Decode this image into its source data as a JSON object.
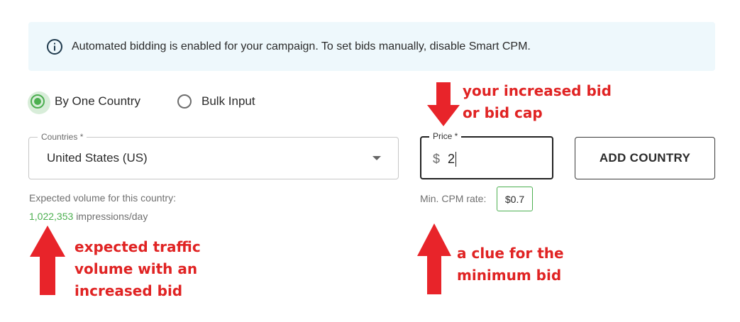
{
  "banner": {
    "text": "Automated bidding is enabled for your campaign. To set bids manually, disable Smart CPM.",
    "icon": "info-icon"
  },
  "radio_options": [
    {
      "label": "By One Country",
      "checked": true
    },
    {
      "label": "Bulk Input",
      "checked": false
    }
  ],
  "countries_field": {
    "label": "Countries *",
    "value": "United States (US)"
  },
  "price_field": {
    "label": "Price *",
    "currency": "$",
    "value": "2"
  },
  "add_button": {
    "label": "ADD COUNTRY"
  },
  "volume": {
    "label": "Expected volume for this country:",
    "number": "1,022,353",
    "unit": "impressions/day"
  },
  "min_cpm": {
    "label": "Min. CPM rate:",
    "value": "$0.7"
  },
  "annotations": {
    "bid": "your increased bid\nor bid cap",
    "volume": "expected traffic\nvolume with an\nincreased bid",
    "min_bid": "a clue for the\nminimum bid"
  },
  "colors": {
    "accent_green": "#4caf50",
    "banner_bg": "#eef8fc",
    "annotation_red": "#e02323"
  }
}
